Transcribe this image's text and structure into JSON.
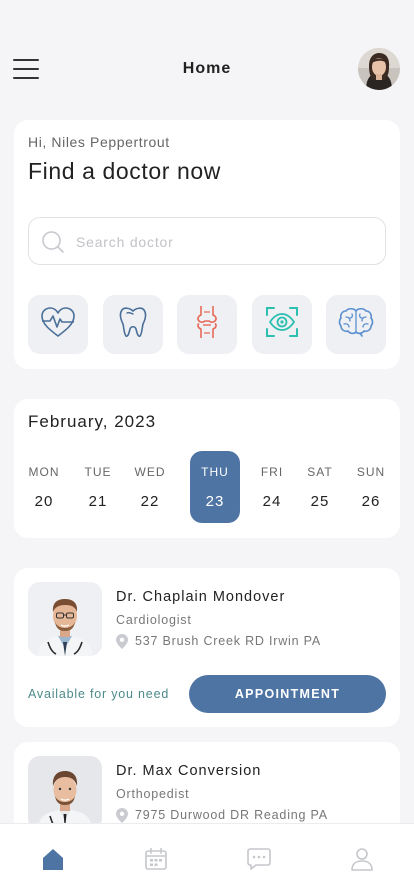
{
  "header": {
    "title": "Home",
    "menu_icon": "hamburger-menu-icon",
    "avatar": "user-avatar"
  },
  "intro": {
    "greeting": "Hi, Niles Peppertrout",
    "headline": "Find a doctor now"
  },
  "search": {
    "placeholder": "Search doctor",
    "value": ""
  },
  "categories": [
    {
      "icon": "heart-icon",
      "color": "#4a6f99"
    },
    {
      "icon": "tooth-icon",
      "color": "#4a6f99"
    },
    {
      "icon": "joint-icon",
      "color": "#e86a5a"
    },
    {
      "icon": "eye-scan-icon",
      "color": "#2bbfb0"
    },
    {
      "icon": "brain-icon",
      "color": "#5a90cf"
    }
  ],
  "calendar": {
    "month": "February, 2023",
    "days": [
      {
        "name": "MON",
        "date": "20"
      },
      {
        "name": "TUE",
        "date": "21"
      },
      {
        "name": "WED",
        "date": "22"
      },
      {
        "name": "THU",
        "date": "23"
      },
      {
        "name": "FRI",
        "date": "24"
      },
      {
        "name": "SAT",
        "date": "25"
      },
      {
        "name": "SUN",
        "date": "26"
      }
    ],
    "selected_index": 3
  },
  "doctors": [
    {
      "name": "Dr. Chaplain Mondover",
      "specialty": "Cardiologist",
      "address": "537 Brush Creek RD Irwin PA",
      "availability": "Available for you need",
      "button": "APPOINTMENT"
    },
    {
      "name": "Dr. Max Conversion",
      "specialty": "Orthopedist",
      "address": "7975 Durwood DR Reading PA"
    }
  ],
  "tabbar": {
    "tabs": [
      "home-icon",
      "calendar-icon",
      "chat-icon",
      "profile-icon"
    ],
    "active_index": 0
  },
  "colors": {
    "accent": "#4e74a4",
    "background": "#f5f5f7",
    "card": "#ffffff",
    "availability": "#4e8a8a"
  }
}
